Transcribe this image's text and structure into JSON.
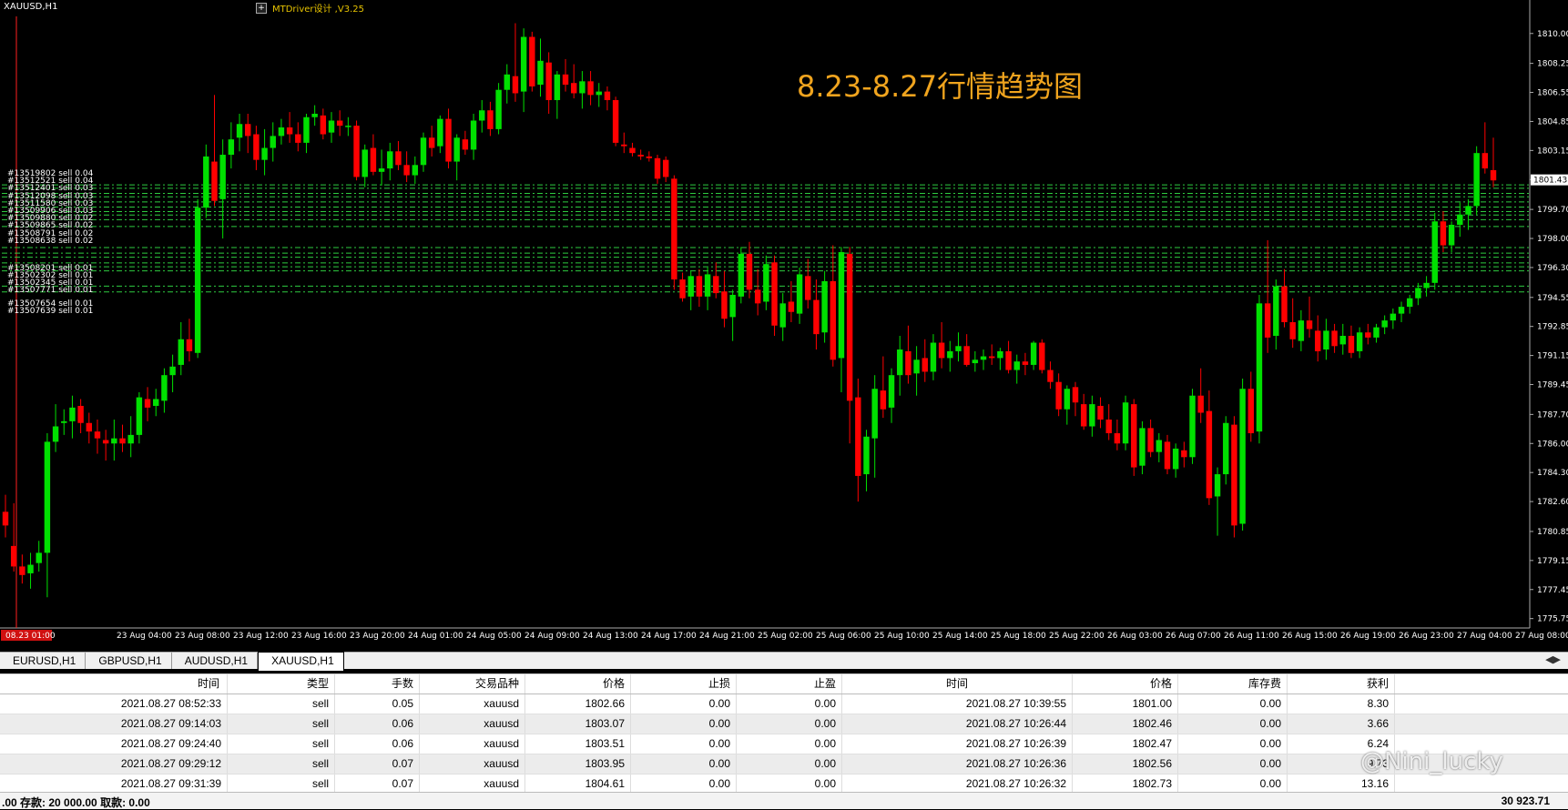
{
  "chart": {
    "symbol_label": "XAUUSD,H1",
    "ea_label": "MTDriver设计 ,V3.25",
    "ea_box_glyph": "+",
    "annotation": "8.23-8.27行情趋势图",
    "current_price": "1801.43",
    "colors": {
      "background": "#000000",
      "bull": "#00e000",
      "bear": "#ff0000",
      "grid_line": "#2ecc40",
      "annotation": "#f0a41e"
    }
  },
  "chart_data": {
    "type": "candlestick",
    "price_axis": [
      "1810.00",
      "1808.25",
      "1806.55",
      "1804.85",
      "1803.15",
      "1801.45",
      "1799.70",
      "1798.00",
      "1796.30",
      "1794.55",
      "1792.85",
      "1791.15",
      "1789.45",
      "1787.70",
      "1786.00",
      "1784.30",
      "1782.60",
      "1780.85",
      "1779.15",
      "1777.45",
      "1775.75"
    ],
    "y_range": [
      1775.2,
      1811.0
    ],
    "time_axis": [
      "08.23 01:00",
      "23 Aug 04:00",
      "23 Aug 08:00",
      "23 Aug 12:00",
      "23 Aug 16:00",
      "23 Aug 20:00",
      "24 Aug 01:00",
      "24 Aug 05:00",
      "24 Aug 09:00",
      "24 Aug 13:00",
      "24 Aug 17:00",
      "24 Aug 21:00",
      "25 Aug 02:00",
      "25 Aug 06:00",
      "25 Aug 10:00",
      "25 Aug 14:00",
      "25 Aug 18:00",
      "25 Aug 22:00",
      "26 Aug 03:00",
      "26 Aug 07:00",
      "26 Aug 11:00",
      "26 Aug 15:00",
      "26 Aug 19:00",
      "26 Aug 23:00",
      "27 Aug 04:00",
      "27 Aug 08:00"
    ],
    "candles": [
      [
        1782.0,
        1783.0,
        1780.5,
        1781.2
      ],
      [
        1780.0,
        1782.5,
        1778.5,
        1778.8
      ],
      [
        1778.8,
        1779.5,
        1777.8,
        1778.3
      ],
      [
        1778.4,
        1779.6,
        1777.5,
        1778.9
      ],
      [
        1779.0,
        1780.3,
        1778.5,
        1779.6
      ],
      [
        1779.6,
        1786.6,
        1777.0,
        1786.1
      ],
      [
        1786.1,
        1788.3,
        1785.5,
        1787.0
      ],
      [
        1787.2,
        1788.0,
        1786.5,
        1787.3
      ],
      [
        1787.3,
        1788.8,
        1786.3,
        1788.1
      ],
      [
        1788.2,
        1788.6,
        1786.6,
        1787.2
      ],
      [
        1787.2,
        1787.8,
        1786.0,
        1786.7
      ],
      [
        1786.7,
        1787.4,
        1785.4,
        1786.3
      ],
      [
        1786.2,
        1786.8,
        1785.0,
        1786.0
      ],
      [
        1786.0,
        1787.4,
        1785.0,
        1786.3
      ],
      [
        1786.3,
        1787.1,
        1785.5,
        1786.0
      ],
      [
        1786.0,
        1787.6,
        1785.2,
        1786.5
      ],
      [
        1786.5,
        1789.0,
        1786.0,
        1788.7
      ],
      [
        1788.6,
        1789.3,
        1787.3,
        1788.1
      ],
      [
        1788.2,
        1789.2,
        1787.6,
        1788.6
      ],
      [
        1788.5,
        1790.4,
        1787.8,
        1790.0
      ],
      [
        1790.0,
        1791.2,
        1789.0,
        1790.5
      ],
      [
        1790.6,
        1793.1,
        1790.0,
        1792.1
      ],
      [
        1792.1,
        1793.3,
        1790.8,
        1791.4
      ],
      [
        1791.3,
        1800.3,
        1791.0,
        1799.8
      ],
      [
        1799.8,
        1803.5,
        1799.2,
        1802.8
      ],
      [
        1802.5,
        1806.4,
        1799.9,
        1800.2
      ],
      [
        1800.3,
        1803.8,
        1798.0,
        1802.9
      ],
      [
        1802.9,
        1804.8,
        1802.1,
        1803.8
      ],
      [
        1803.9,
        1805.3,
        1803.1,
        1804.7
      ],
      [
        1804.7,
        1805.3,
        1803.0,
        1804.0
      ],
      [
        1804.1,
        1804.6,
        1802.0,
        1802.6
      ],
      [
        1802.6,
        1804.4,
        1801.7,
        1803.3
      ],
      [
        1803.3,
        1804.8,
        1802.5,
        1804.0
      ],
      [
        1804.0,
        1805.0,
        1803.5,
        1804.5
      ],
      [
        1804.5,
        1805.4,
        1803.6,
        1804.1
      ],
      [
        1804.1,
        1804.8,
        1803.1,
        1803.6
      ],
      [
        1803.6,
        1805.3,
        1803.0,
        1805.1
      ],
      [
        1805.1,
        1805.8,
        1804.6,
        1805.3
      ],
      [
        1805.2,
        1805.6,
        1803.8,
        1804.1
      ],
      [
        1804.2,
        1805.4,
        1803.6,
        1804.9
      ],
      [
        1804.9,
        1805.5,
        1804.0,
        1804.6
      ],
      [
        1804.6,
        1805.1,
        1804.0,
        1804.6
      ],
      [
        1804.6,
        1804.9,
        1801.4,
        1801.6
      ],
      [
        1801.6,
        1803.5,
        1801.0,
        1803.2
      ],
      [
        1803.3,
        1804.1,
        1801.7,
        1801.9
      ],
      [
        1801.9,
        1803.2,
        1801.1,
        1802.1
      ],
      [
        1802.1,
        1803.6,
        1801.4,
        1803.1
      ],
      [
        1803.1,
        1803.7,
        1802.0,
        1802.3
      ],
      [
        1802.3,
        1803.1,
        1801.3,
        1801.7
      ],
      [
        1801.7,
        1802.8,
        1801.2,
        1802.3
      ],
      [
        1802.3,
        1804.2,
        1801.9,
        1803.9
      ],
      [
        1803.9,
        1804.6,
        1802.8,
        1803.3
      ],
      [
        1803.4,
        1805.2,
        1803.0,
        1805.0
      ],
      [
        1805.0,
        1805.6,
        1802.1,
        1802.5
      ],
      [
        1802.5,
        1804.1,
        1801.4,
        1803.9
      ],
      [
        1803.8,
        1804.3,
        1802.9,
        1803.2
      ],
      [
        1803.2,
        1805.3,
        1802.6,
        1804.9
      ],
      [
        1804.9,
        1806.1,
        1804.2,
        1805.5
      ],
      [
        1805.5,
        1806.0,
        1804.0,
        1804.4
      ],
      [
        1804.4,
        1807.1,
        1804.1,
        1806.7
      ],
      [
        1806.7,
        1808.2,
        1805.9,
        1807.6
      ],
      [
        1807.5,
        1810.6,
        1806.0,
        1806.5
      ],
      [
        1806.6,
        1810.3,
        1805.4,
        1809.8
      ],
      [
        1809.8,
        1810.1,
        1806.6,
        1806.9
      ],
      [
        1807.0,
        1809.7,
        1806.3,
        1808.4
      ],
      [
        1808.3,
        1808.9,
        1805.3,
        1806.1
      ],
      [
        1806.1,
        1807.8,
        1805.0,
        1807.6
      ],
      [
        1807.6,
        1808.5,
        1806.6,
        1807.0
      ],
      [
        1807.1,
        1808.2,
        1806.2,
        1806.5
      ],
      [
        1806.5,
        1807.8,
        1805.6,
        1807.2
      ],
      [
        1807.2,
        1807.8,
        1805.8,
        1806.4
      ],
      [
        1806.4,
        1807.1,
        1805.7,
        1806.6
      ],
      [
        1806.6,
        1806.9,
        1805.5,
        1806.1
      ],
      [
        1806.1,
        1806.3,
        1803.4,
        1803.6
      ],
      [
        1803.5,
        1804.2,
        1803.0,
        1803.4
      ],
      [
        1803.3,
        1803.6,
        1802.8,
        1803.0
      ],
      [
        1802.9,
        1803.2,
        1802.6,
        1802.8
      ],
      [
        1802.8,
        1803.1,
        1802.5,
        1802.7
      ],
      [
        1802.7,
        1802.9,
        1801.2,
        1801.5
      ],
      [
        1802.6,
        1802.8,
        1801.3,
        1801.6
      ],
      [
        1801.5,
        1801.7,
        1795.0,
        1795.6
      ],
      [
        1795.6,
        1796.0,
        1794.3,
        1794.5
      ],
      [
        1794.6,
        1796.1,
        1793.8,
        1795.8
      ],
      [
        1795.8,
        1796.2,
        1794.0,
        1794.6
      ],
      [
        1794.6,
        1796.3,
        1793.8,
        1795.9
      ],
      [
        1795.8,
        1796.6,
        1794.5,
        1794.8
      ],
      [
        1794.9,
        1796.1,
        1792.8,
        1793.3
      ],
      [
        1793.4,
        1795.0,
        1792.0,
        1794.7
      ],
      [
        1794.6,
        1797.5,
        1794.2,
        1797.1
      ],
      [
        1797.1,
        1797.8,
        1794.5,
        1795.0
      ],
      [
        1795.0,
        1796.2,
        1793.5,
        1794.2
      ],
      [
        1794.3,
        1797.0,
        1793.8,
        1796.5
      ],
      [
        1796.6,
        1797.0,
        1792.3,
        1792.9
      ],
      [
        1792.8,
        1794.8,
        1792.0,
        1794.2
      ],
      [
        1794.3,
        1795.5,
        1793.1,
        1793.7
      ],
      [
        1793.6,
        1796.3,
        1793.0,
        1795.9
      ],
      [
        1795.8,
        1796.8,
        1793.9,
        1794.4
      ],
      [
        1794.4,
        1795.6,
        1791.5,
        1792.4
      ],
      [
        1792.5,
        1796.1,
        1791.9,
        1795.5
      ],
      [
        1795.5,
        1797.6,
        1790.5,
        1790.9
      ],
      [
        1791.0,
        1797.5,
        1789.0,
        1797.2
      ],
      [
        1797.1,
        1797.5,
        1786.0,
        1788.5
      ],
      [
        1788.7,
        1789.8,
        1782.6,
        1784.1
      ],
      [
        1784.2,
        1786.8,
        1783.2,
        1786.4
      ],
      [
        1786.3,
        1790.0,
        1784.0,
        1789.2
      ],
      [
        1789.1,
        1791.1,
        1787.5,
        1788.0
      ],
      [
        1788.1,
        1790.4,
        1787.2,
        1790.0
      ],
      [
        1790.0,
        1792.3,
        1788.8,
        1791.5
      ],
      [
        1791.4,
        1792.9,
        1789.5,
        1790.0
      ],
      [
        1790.1,
        1791.7,
        1788.8,
        1790.9
      ],
      [
        1791.0,
        1792.1,
        1789.6,
        1790.2
      ],
      [
        1790.2,
        1792.4,
        1789.7,
        1791.9
      ],
      [
        1791.9,
        1793.1,
        1790.4,
        1791.0
      ],
      [
        1791.0,
        1792.0,
        1790.2,
        1791.4
      ],
      [
        1791.4,
        1792.5,
        1790.8,
        1791.7
      ],
      [
        1791.7,
        1792.4,
        1790.5,
        1790.6
      ],
      [
        1790.7,
        1791.4,
        1790.2,
        1790.9
      ],
      [
        1790.9,
        1791.5,
        1790.3,
        1791.1
      ],
      [
        1791.1,
        1791.8,
        1790.6,
        1791.0
      ],
      [
        1791.0,
        1791.6,
        1790.3,
        1791.4
      ],
      [
        1791.4,
        1792.0,
        1790.1,
        1790.3
      ],
      [
        1790.3,
        1791.2,
        1789.5,
        1790.8
      ],
      [
        1790.8,
        1791.3,
        1790.0,
        1790.6
      ],
      [
        1790.6,
        1792.0,
        1790.3,
        1791.9
      ],
      [
        1791.9,
        1792.1,
        1790.1,
        1790.3
      ],
      [
        1790.3,
        1790.8,
        1789.2,
        1789.6
      ],
      [
        1789.6,
        1790.1,
        1787.6,
        1788.0
      ],
      [
        1788.0,
        1789.4,
        1787.1,
        1789.2
      ],
      [
        1789.3,
        1789.6,
        1787.6,
        1788.4
      ],
      [
        1788.3,
        1788.9,
        1786.8,
        1787.0
      ],
      [
        1787.0,
        1788.8,
        1786.4,
        1788.3
      ],
      [
        1788.2,
        1788.7,
        1786.9,
        1787.4
      ],
      [
        1787.4,
        1788.3,
        1786.2,
        1786.6
      ],
      [
        1786.6,
        1787.4,
        1785.6,
        1786.0
      ],
      [
        1786.0,
        1788.8,
        1785.6,
        1788.4
      ],
      [
        1788.3,
        1788.6,
        1784.1,
        1784.6
      ],
      [
        1784.7,
        1787.3,
        1784.2,
        1786.9
      ],
      [
        1786.9,
        1787.4,
        1785.2,
        1785.5
      ],
      [
        1785.5,
        1786.6,
        1784.9,
        1786.2
      ],
      [
        1786.1,
        1786.5,
        1784.2,
        1784.5
      ],
      [
        1784.5,
        1786.0,
        1784.0,
        1785.7
      ],
      [
        1785.6,
        1786.1,
        1784.6,
        1785.2
      ],
      [
        1785.2,
        1789.2,
        1784.8,
        1788.8
      ],
      [
        1788.8,
        1790.4,
        1787.2,
        1787.8
      ],
      [
        1787.9,
        1789.1,
        1782.4,
        1782.8
      ],
      [
        1782.9,
        1784.6,
        1780.6,
        1784.2
      ],
      [
        1784.2,
        1787.6,
        1783.6,
        1787.2
      ],
      [
        1787.1,
        1787.6,
        1780.5,
        1781.2
      ],
      [
        1781.3,
        1789.8,
        1780.9,
        1789.2
      ],
      [
        1789.2,
        1790.2,
        1786.1,
        1786.6
      ],
      [
        1786.7,
        1794.7,
        1786.0,
        1794.2
      ],
      [
        1794.2,
        1797.9,
        1791.3,
        1792.2
      ],
      [
        1792.3,
        1795.6,
        1791.5,
        1795.2
      ],
      [
        1795.2,
        1796.2,
        1792.8,
        1793.1
      ],
      [
        1793.1,
        1794.5,
        1791.6,
        1792.1
      ],
      [
        1792.0,
        1793.8,
        1791.4,
        1793.2
      ],
      [
        1793.2,
        1794.6,
        1792.2,
        1792.7
      ],
      [
        1792.6,
        1793.5,
        1790.8,
        1791.4
      ],
      [
        1791.5,
        1793.3,
        1790.9,
        1792.6
      ],
      [
        1792.6,
        1793.0,
        1791.3,
        1791.7
      ],
      [
        1791.8,
        1793.0,
        1791.2,
        1792.3
      ],
      [
        1792.3,
        1792.9,
        1791.0,
        1791.3
      ],
      [
        1791.4,
        1792.8,
        1791.0,
        1792.5
      ],
      [
        1792.5,
        1793.0,
        1791.8,
        1792.2
      ],
      [
        1792.2,
        1793.0,
        1791.9,
        1792.8
      ],
      [
        1792.8,
        1793.5,
        1792.4,
        1793.2
      ],
      [
        1793.2,
        1793.9,
        1792.7,
        1793.6
      ],
      [
        1793.6,
        1794.3,
        1793.1,
        1794.0
      ],
      [
        1794.0,
        1794.7,
        1793.6,
        1794.5
      ],
      [
        1794.5,
        1795.4,
        1794.1,
        1795.1
      ],
      [
        1795.1,
        1795.8,
        1794.6,
        1795.4
      ],
      [
        1795.4,
        1799.5,
        1795.0,
        1799.0
      ],
      [
        1799.0,
        1799.6,
        1797.2,
        1797.6
      ],
      [
        1797.6,
        1799.0,
        1797.2,
        1798.8
      ],
      [
        1798.8,
        1800.1,
        1798.1,
        1799.4
      ],
      [
        1799.4,
        1800.3,
        1798.5,
        1799.9
      ],
      [
        1799.9,
        1803.4,
        1799.4,
        1803.0
      ],
      [
        1803.0,
        1804.8,
        1801.8,
        1802.1
      ],
      [
        1802.0,
        1803.9,
        1801.0,
        1801.4
      ]
    ],
    "order_lines": [
      1801.14,
      1800.94,
      1800.64,
      1800.44,
      1800.14,
      1799.84,
      1799.57,
      1799.37,
      1799.1,
      1798.7,
      1797.47,
      1797.14,
      1796.9,
      1796.57,
      1796.34,
      1796.1,
      1795.21,
      1794.87
    ],
    "order_labels": [
      "#13519802 sell 0.04",
      "#13512521 sell 0.04",
      "#13512401 sell 0.03",
      "#13512098 sell 0.03",
      "#13511580 sell 0.03",
      "#13509906 sell 0.03",
      "#13509880 sell 0.02",
      "#13509865 sell 0.02",
      "#13508791 sell 0.02",
      "#13508638 sell 0.02",
      "#13508201 sell 0.01",
      "#13502302 sell 0.01",
      "#13502345 sell 0.01",
      "#13507771 sell 0.01",
      "#13507654 sell 0.01",
      "#13507639 sell 0.01"
    ]
  },
  "tabs": [
    {
      "label": "EURUSD,H1",
      "active": false
    },
    {
      "label": "GBPUSD,H1",
      "active": false
    },
    {
      "label": "AUDUSD,H1",
      "active": false
    },
    {
      "label": "XAUUSD,H1",
      "active": true
    }
  ],
  "tabs_scroll_glyph": "◀▶",
  "grid": {
    "headers": [
      "时间",
      "类型",
      "手数",
      "交易品种",
      "价格",
      "止损",
      "止盈",
      "时间",
      "价格",
      "库存费",
      "获利"
    ],
    "rows": [
      [
        "2021.08.27 08:52:33",
        "sell",
        "0.05",
        "xauusd",
        "1802.66",
        "0.00",
        "0.00",
        "2021.08.27 10:39:55",
        "1801.00",
        "0.00",
        "8.30"
      ],
      [
        "2021.08.27 09:14:03",
        "sell",
        "0.06",
        "xauusd",
        "1803.07",
        "0.00",
        "0.00",
        "2021.08.27 10:26:44",
        "1802.46",
        "0.00",
        "3.66"
      ],
      [
        "2021.08.27 09:24:40",
        "sell",
        "0.06",
        "xauusd",
        "1803.51",
        "0.00",
        "0.00",
        "2021.08.27 10:26:39",
        "1802.47",
        "0.00",
        "6.24"
      ],
      [
        "2021.08.27 09:29:12",
        "sell",
        "0.07",
        "xauusd",
        "1803.95",
        "0.00",
        "0.00",
        "2021.08.27 10:26:36",
        "1802.56",
        "0.00",
        "9.73"
      ],
      [
        "2021.08.27 09:31:39",
        "sell",
        "0.07",
        "xauusd",
        "1804.61",
        "0.00",
        "0.00",
        "2021.08.27 10:26:32",
        "1802.73",
        "0.00",
        "13.16"
      ]
    ]
  },
  "status": {
    "left": ".00  存款: 20 000.00  取款: 0.00",
    "right": "30 923.71"
  },
  "watermark": "@Nini_lucky"
}
